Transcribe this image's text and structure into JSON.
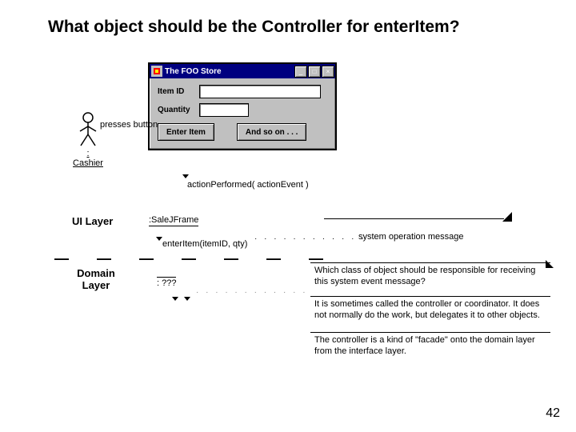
{
  "title": "What object should be the Controller for enterItem?",
  "window": {
    "title": "The FOO Store",
    "fields": {
      "item_id_label": "Item ID",
      "quantity_label": "Quantity"
    },
    "buttons": {
      "enter_item": "Enter Item",
      "and_so_on": "And so on . . ."
    }
  },
  "actor": {
    "label": ": Cashier",
    "action": "presses button"
  },
  "callouts": {
    "action_performed": "actionPerformed( actionEvent )",
    "ui_layer": "UI Layer",
    "sale_jframe": ":SaleJFrame",
    "enter_item": "enterItem(itemID, qty)",
    "system_op_msg": "system operation message",
    "domain_layer": "Domain Layer",
    "unknown": ": ???"
  },
  "notes": {
    "q1": "Which class of object should be responsible for receiving this system event message?",
    "q2": "It is sometimes called the controller or coordinator. It does not normally do the work, but delegates it to other objects.",
    "q3": "The controller is a kind of \"facade\" onto the domain layer from the interface layer."
  },
  "slide_number": "42",
  "dashrow": "— — — — — — —"
}
